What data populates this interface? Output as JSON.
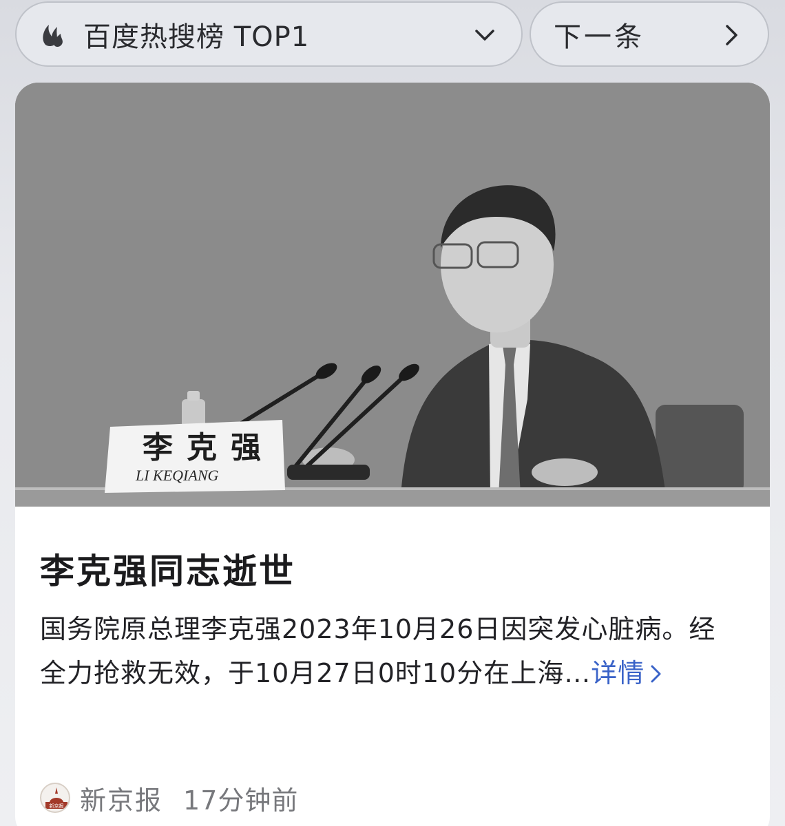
{
  "topbar": {
    "hot_list_label": "百度热搜榜 TOP1",
    "next_label": "下一条",
    "icons": {
      "brand": "baidu-flame-icon",
      "expand": "chevron-down-icon",
      "next": "chevron-right-icon"
    }
  },
  "news": {
    "nameplate_cn": "李克强",
    "nameplate_en": "LI KEQIANG",
    "headline": "李克强同志逝世",
    "summary": "国务院原总理李克强2023年10月26日因突发心脏病。经全力抢救无效，于10月27日0时10分在上海…",
    "more_link": "详情",
    "source": {
      "logo_text": "新京报",
      "name": "新京报",
      "time": "17分钟前"
    }
  },
  "colors": {
    "link": "#3a63c8",
    "headline": "#1b1b1d",
    "meta": "#77787c"
  }
}
